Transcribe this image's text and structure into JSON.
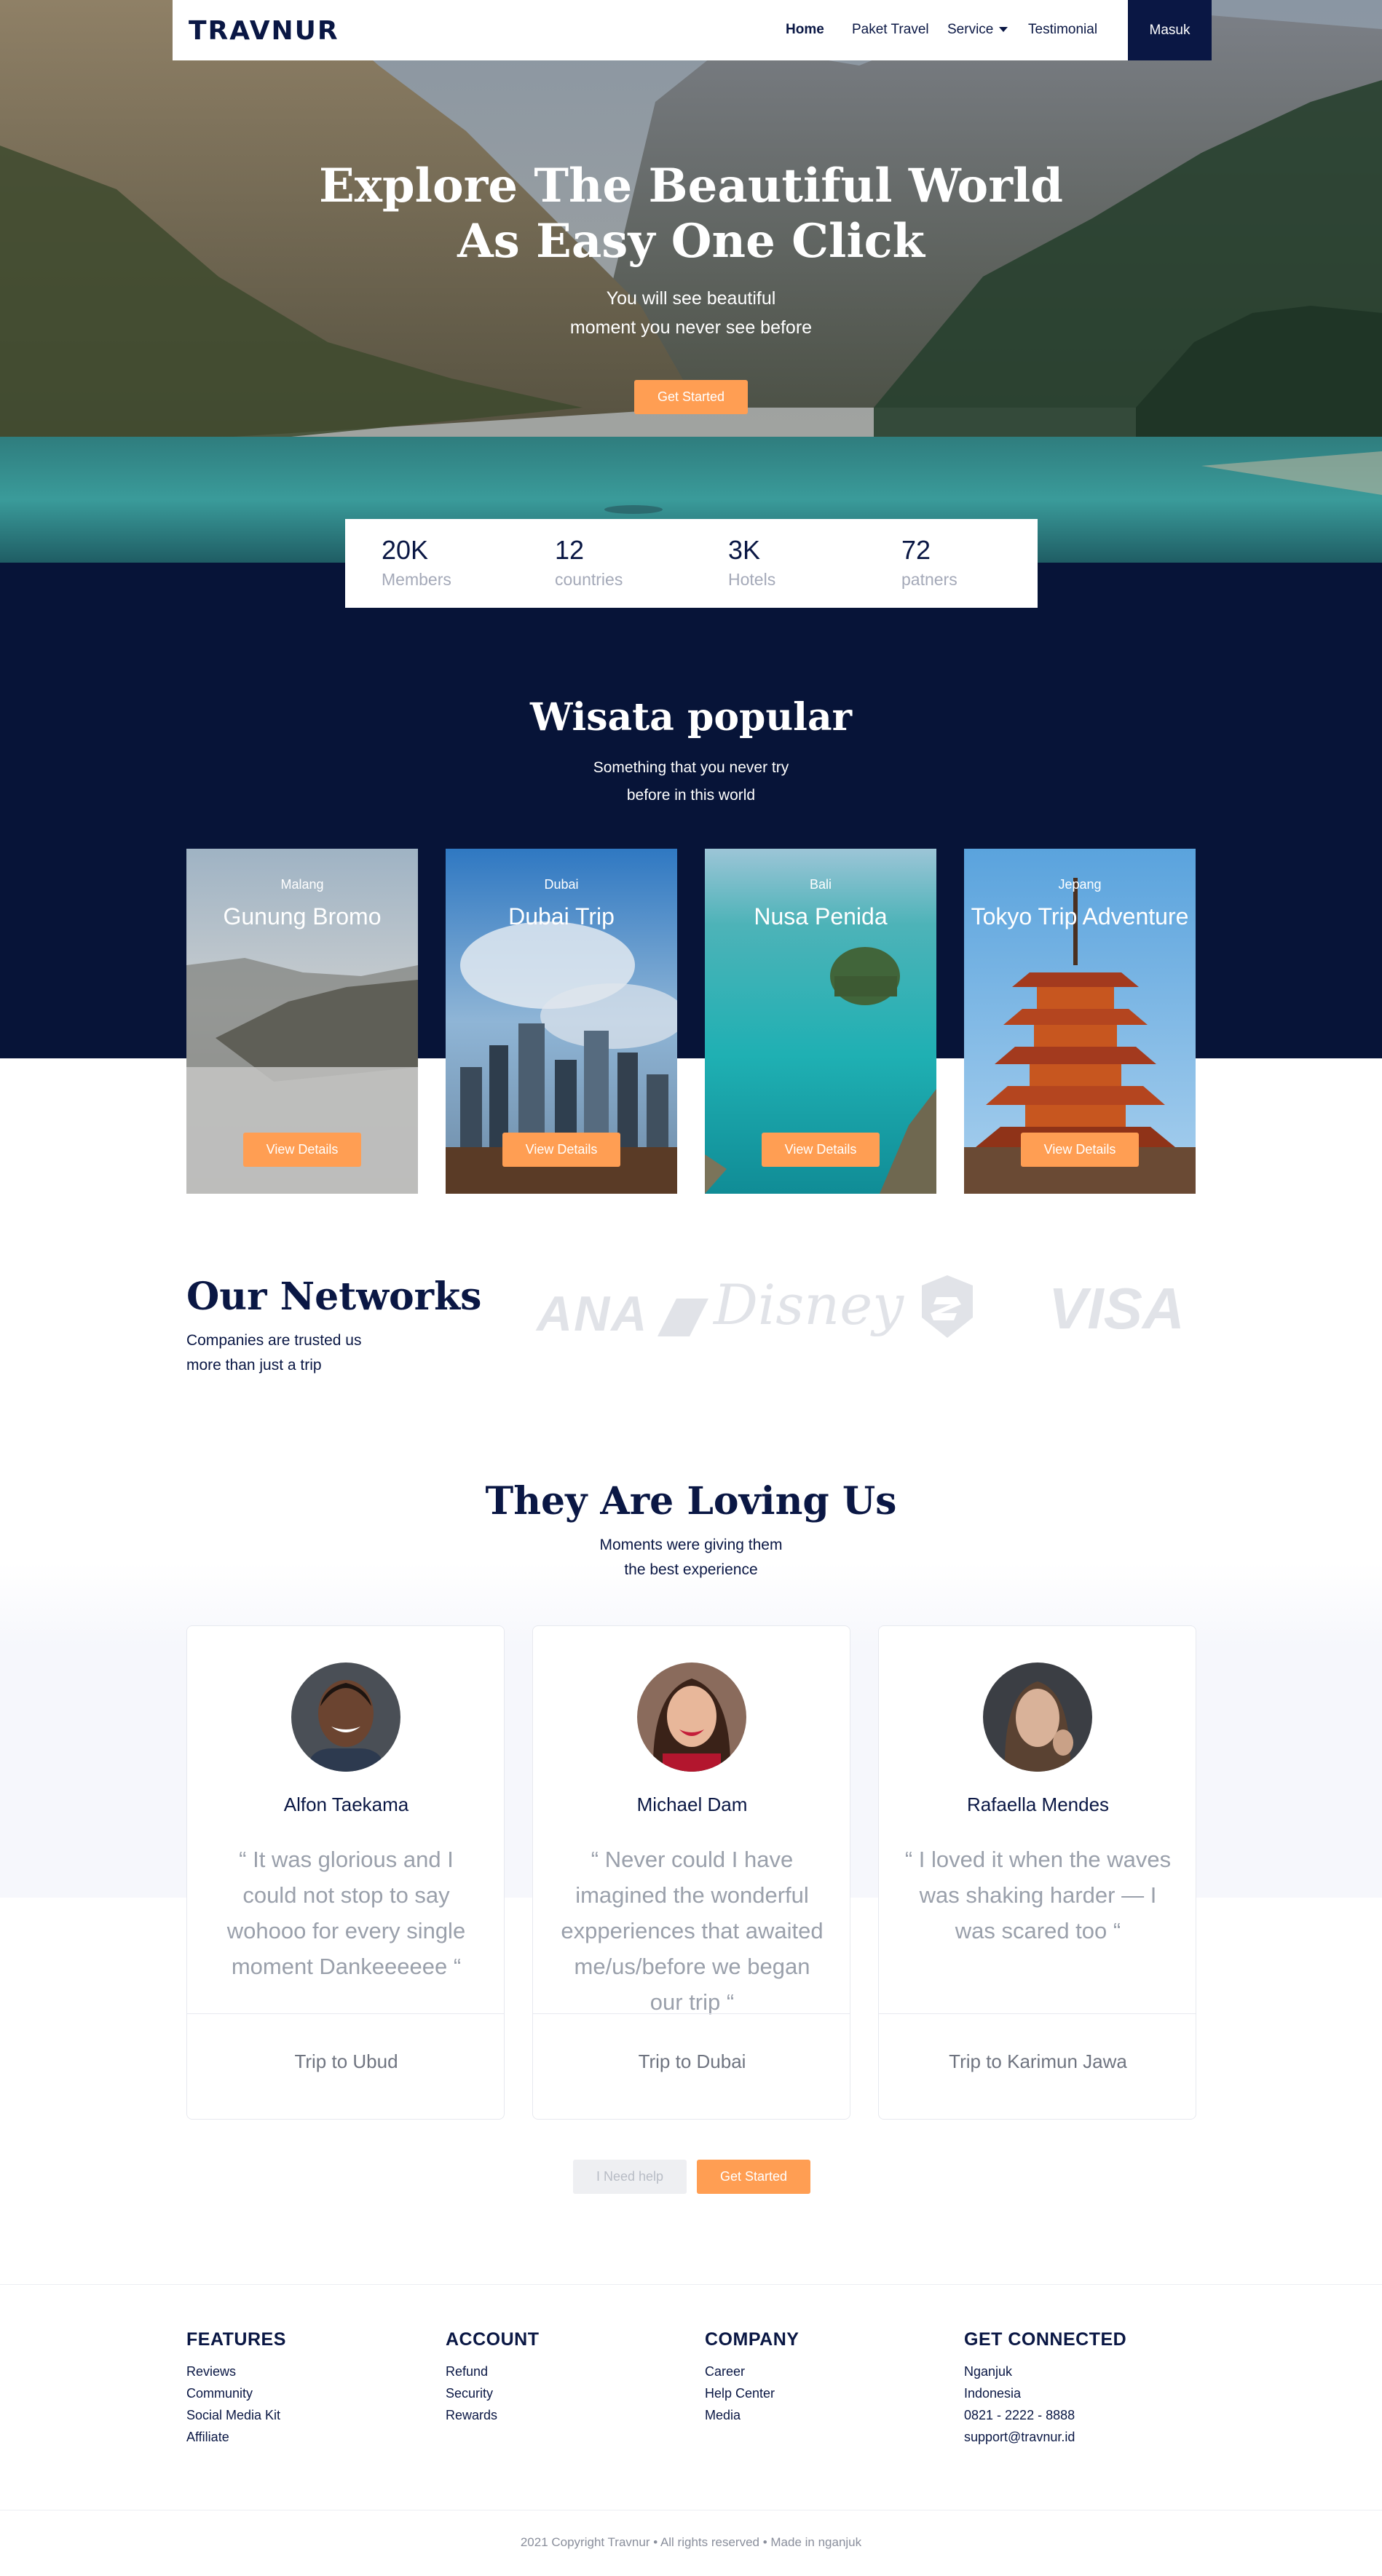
{
  "nav": {
    "logo": "TRAVNUR",
    "links": [
      "Home",
      "Paket Travel",
      "Service",
      "Testimonial"
    ],
    "login": "Masuk"
  },
  "hero": {
    "title_line1": "Explore The Beautiful World",
    "title_line2": "As Easy One Click",
    "sub_line1": "You will see beautiful",
    "sub_line2": "moment you never see before",
    "cta": "Get Started"
  },
  "stats": [
    {
      "value": "20K",
      "label": "Members"
    },
    {
      "value": "12",
      "label": "countries"
    },
    {
      "value": "3K",
      "label": "Hotels"
    },
    {
      "value": "72",
      "label": "patners"
    }
  ],
  "popular": {
    "title": "Wisata popular",
    "sub_line1": "Something that you never try",
    "sub_line2": "before in this world",
    "cards": [
      {
        "category": "Malang",
        "title": "Gunung Bromo",
        "button": "View Details"
      },
      {
        "category": "Dubai",
        "title": "Dubai Trip",
        "button": "View Details"
      },
      {
        "category": "Bali",
        "title": "Nusa Penida",
        "button": "View Details"
      },
      {
        "category": "Jepang",
        "title": "Tokyo Trip Adventure",
        "button": "View Details"
      }
    ]
  },
  "networks": {
    "title": "Our Networks",
    "sub_line1": "Companies are trusted us",
    "sub_line2": "more than just a trip",
    "partners": [
      "ANA",
      "Disney",
      "Shield",
      "VISA"
    ]
  },
  "testimonials": {
    "title": "They Are Loving Us",
    "sub_line1": "Moments were giving them",
    "sub_line2": "the best experience",
    "items": [
      {
        "name": "Alfon Taekama",
        "quote": "“ It was glorious and I could not stop to say wohooo for every single moment Dankeeeeee “",
        "trip": "Trip to Ubud"
      },
      {
        "name": "Michael Dam",
        "quote": "“ Never could I have imagined the wonderful expperiences that awaited me/us/before we began our trip “",
        "trip": "Trip to Dubai"
      },
      {
        "name": "Rafaella Mendes",
        "quote": "“ I loved it when the waves was shaking harder — I was scared too “",
        "trip": "Trip to Karimun Jawa"
      }
    ],
    "help_button": "I Need help",
    "cta": "Get Started"
  },
  "footer": {
    "columns": [
      {
        "title": "FEATURES",
        "items": [
          "Reviews",
          "Community",
          "Social Media Kit",
          "Affiliate"
        ]
      },
      {
        "title": "ACCOUNT",
        "items": [
          "Refund",
          "Security",
          "Rewards"
        ]
      },
      {
        "title": "COMPANY",
        "items": [
          "Career",
          "Help Center",
          "Media"
        ]
      },
      {
        "title": "GET CONNECTED",
        "items": [
          "Nganjuk",
          "Indonesia",
          "0821 - 2222 - 8888",
          "support@travnur.id"
        ]
      }
    ],
    "copyright": "2021 Copyright Travnur • All rights reserved • Made in nganjuk"
  },
  "colors": {
    "navy": "#0a1744",
    "dark_section": "#071438",
    "accent": "#ff9e53"
  }
}
